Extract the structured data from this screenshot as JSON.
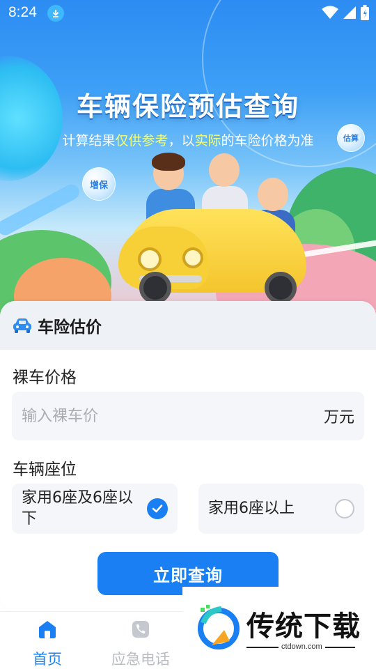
{
  "status_bar": {
    "time": "8:24"
  },
  "hero": {
    "title": "车辆保险预估查询",
    "subtitle_parts": [
      "计算结果",
      "仅供参考",
      "，以",
      "实际",
      "的车险价格为准"
    ],
    "bubble_left": "增保",
    "bubble_right": "估算"
  },
  "card": {
    "title": "车险估价",
    "price_label": "裸车价格",
    "price_placeholder": "输入裸车价",
    "price_value": "",
    "price_unit": "万元",
    "seats_label": "车辆座位",
    "seat_options": [
      {
        "label": "家用6座及6座以下",
        "selected": true
      },
      {
        "label": "家用6座以上",
        "selected": false
      }
    ],
    "submit_label": "立即查询"
  },
  "bottom_nav": {
    "items": [
      {
        "label": "首页",
        "icon": "home-icon",
        "active": true
      },
      {
        "label": "应急电话",
        "icon": "phone-icon",
        "active": false
      }
    ]
  },
  "watermark": {
    "brand": "传统下载",
    "url": "ctdown.com"
  },
  "colors": {
    "accent": "#1a7ff2",
    "highlight": "#f6ff6a",
    "inactive": "#b9bcc3"
  }
}
